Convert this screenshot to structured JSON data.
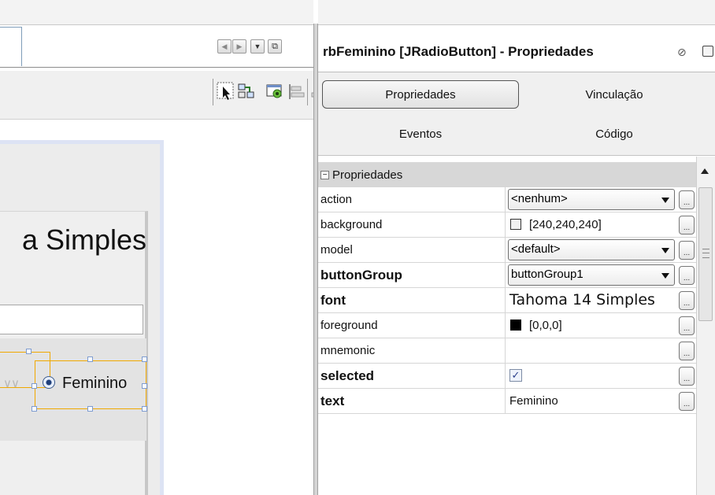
{
  "colors": {
    "selection": "#f0a800",
    "handle_border": "#7d9bd0",
    "background_swatch": "#f0f0f0",
    "foreground_swatch": "#000000"
  },
  "designer": {
    "form_title_fragment": "a Simples",
    "radio_button_label": "Feminino",
    "ghost_component": "∨∨",
    "toolbar_icons": [
      "selection-mode-icon",
      "connection-mode-icon",
      "preview-design-icon",
      "align-left-icon",
      "align-right-icon",
      "center-horizontal-icon",
      "align-top-icon",
      "align-bottom-icon",
      "center-vertical-icon"
    ]
  },
  "properties": {
    "title": "rbFeminino [JRadioButton] - Propriedades",
    "close_glyph": "⊘",
    "tabs": {
      "propriedades": "Propriedades",
      "vinculacao": "Vinculação",
      "eventos": "Eventos",
      "codigo": "Código"
    },
    "section": {
      "toggle": "−",
      "label": "Propriedades"
    },
    "ellipsis": "...",
    "rows": {
      "action": {
        "name": "action",
        "value": "<nenhum>"
      },
      "background": {
        "name": "background",
        "value": "[240,240,240]"
      },
      "model": {
        "name": "model",
        "value": "<default>"
      },
      "buttonGroup": {
        "name": "buttonGroup",
        "value": "buttonGroup1"
      },
      "font": {
        "name": "font",
        "value": "Tahoma 14 Simples"
      },
      "foreground": {
        "name": "foreground",
        "value": "[0,0,0]"
      },
      "mnemonic": {
        "name": "mnemonic",
        "value": ""
      },
      "selected": {
        "name": "selected",
        "checked": true,
        "check_glyph": "✓"
      },
      "text": {
        "name": "text",
        "value": "Feminino"
      }
    }
  }
}
